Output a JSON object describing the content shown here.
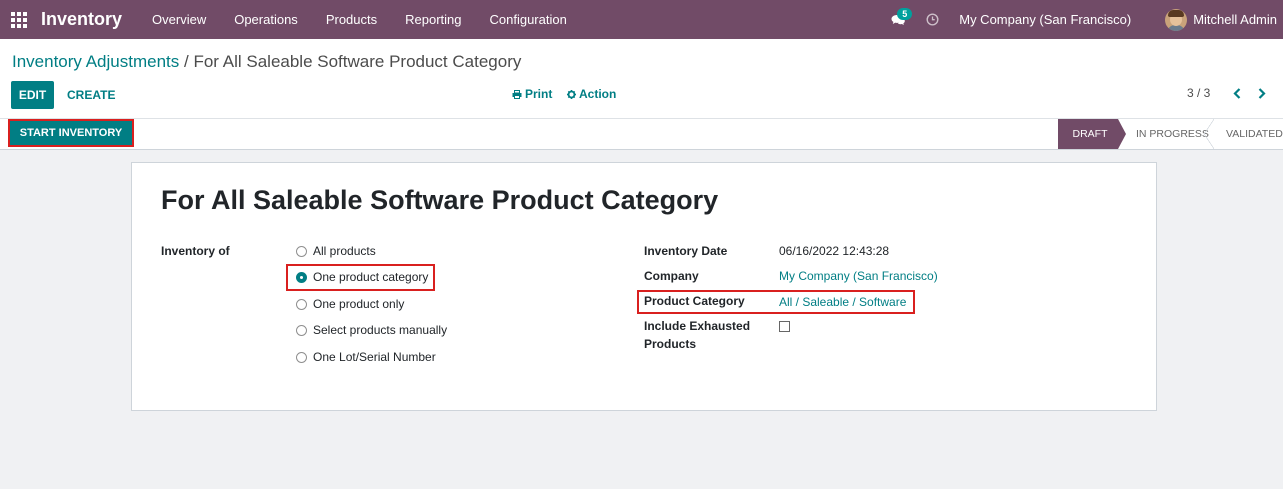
{
  "topnav": {
    "app_name": "Inventory",
    "menu": [
      "Overview",
      "Operations",
      "Products",
      "Reporting",
      "Configuration"
    ],
    "chat_badge": "5",
    "company": "My Company (San Francisco)",
    "user": "Mitchell Admin"
  },
  "breadcrumb": {
    "parent": "Inventory Adjustments",
    "separator": "/",
    "current": "For All Saleable Software Product Category"
  },
  "toolbar": {
    "edit": "EDIT",
    "create": "CREATE",
    "print": "Print",
    "action": "Action",
    "pager": "3 / 3"
  },
  "statusbar": {
    "start_button": "START INVENTORY",
    "stages": [
      "DRAFT",
      "IN PROGRESS",
      "VALIDATED"
    ],
    "active_stage": "DRAFT"
  },
  "form": {
    "title": "For All Saleable Software Product Category",
    "inventory_of_label": "Inventory of",
    "inventory_of_options": [
      "All products",
      "One product category",
      "One product only",
      "Select products manually",
      "One Lot/Serial Number"
    ],
    "inventory_of_selected": "One product category",
    "inventory_date_label": "Inventory Date",
    "inventory_date": "06/16/2022 12:43:28",
    "company_label": "Company",
    "company": "My Company (San Francisco)",
    "product_category_label": "Product Category",
    "product_category": "All / Saleable / Software",
    "include_exhausted_label_1": "Include Exhausted",
    "include_exhausted_label_2": "Products",
    "include_exhausted": false
  },
  "colors": {
    "brand": "#714b67",
    "accent": "#017e84",
    "highlight": "#d9201f"
  },
  "icons": [
    "apps-grid-icon",
    "chat-icon",
    "clock-icon",
    "print-icon",
    "gear-icon",
    "chevron-left-icon",
    "chevron-right-icon"
  ]
}
